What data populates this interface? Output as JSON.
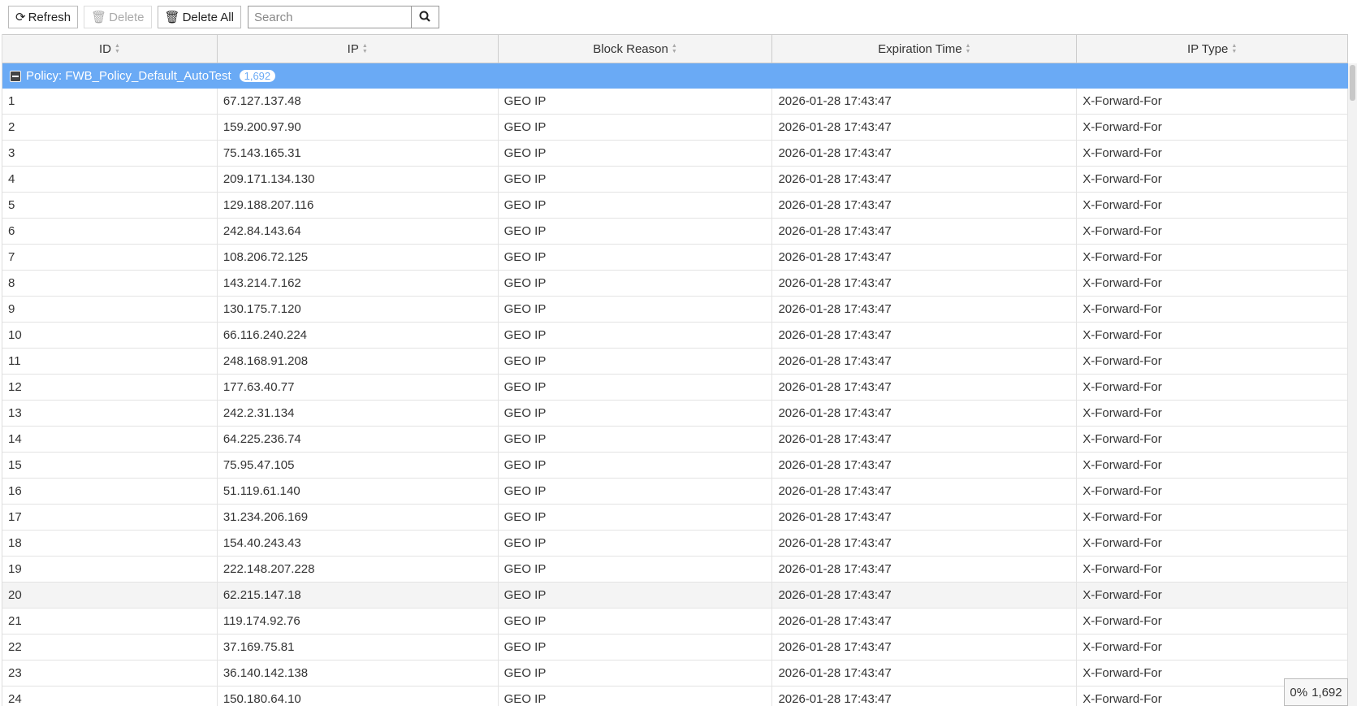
{
  "toolbar": {
    "refresh": "Refresh",
    "delete": "Delete",
    "delete_all": "Delete All",
    "search_placeholder": "Search"
  },
  "columns": [
    "ID",
    "IP",
    "Block Reason",
    "Expiration Time",
    "IP Type"
  ],
  "group": {
    "label": "Policy: FWB_Policy_Default_AutoTest",
    "count": "1,692"
  },
  "rows": [
    [
      "1",
      "67.127.137.48"
    ],
    [
      "2",
      "159.200.97.90"
    ],
    [
      "3",
      "75.143.165.31"
    ],
    [
      "4",
      "209.171.134.130"
    ],
    [
      "5",
      "129.188.207.116"
    ],
    [
      "6",
      "242.84.143.64"
    ],
    [
      "7",
      "108.206.72.125"
    ],
    [
      "8",
      "143.214.7.162"
    ],
    [
      "9",
      "130.175.7.120"
    ],
    [
      "10",
      "66.116.240.224"
    ],
    [
      "11",
      "248.168.91.208"
    ],
    [
      "12",
      "177.63.40.77"
    ],
    [
      "13",
      "242.2.31.134"
    ],
    [
      "14",
      "64.225.236.74"
    ],
    [
      "15",
      "75.95.47.105"
    ],
    [
      "16",
      "51.119.61.140"
    ],
    [
      "17",
      "31.234.206.169"
    ],
    [
      "18",
      "154.40.243.43"
    ],
    [
      "19",
      "222.148.207.228"
    ],
    [
      "20",
      "62.215.147.18"
    ],
    [
      "21",
      "119.174.92.76"
    ],
    [
      "22",
      "37.169.75.81"
    ],
    [
      "23",
      "36.140.142.138"
    ],
    [
      "24",
      "150.180.64.10"
    ]
  ],
  "row_common": {
    "reason": "GEO IP",
    "expiration": "2026-01-28 17:43:47",
    "ip_type": "X-Forward-For"
  },
  "footer": {
    "percent": "0%",
    "total": "1,692"
  }
}
